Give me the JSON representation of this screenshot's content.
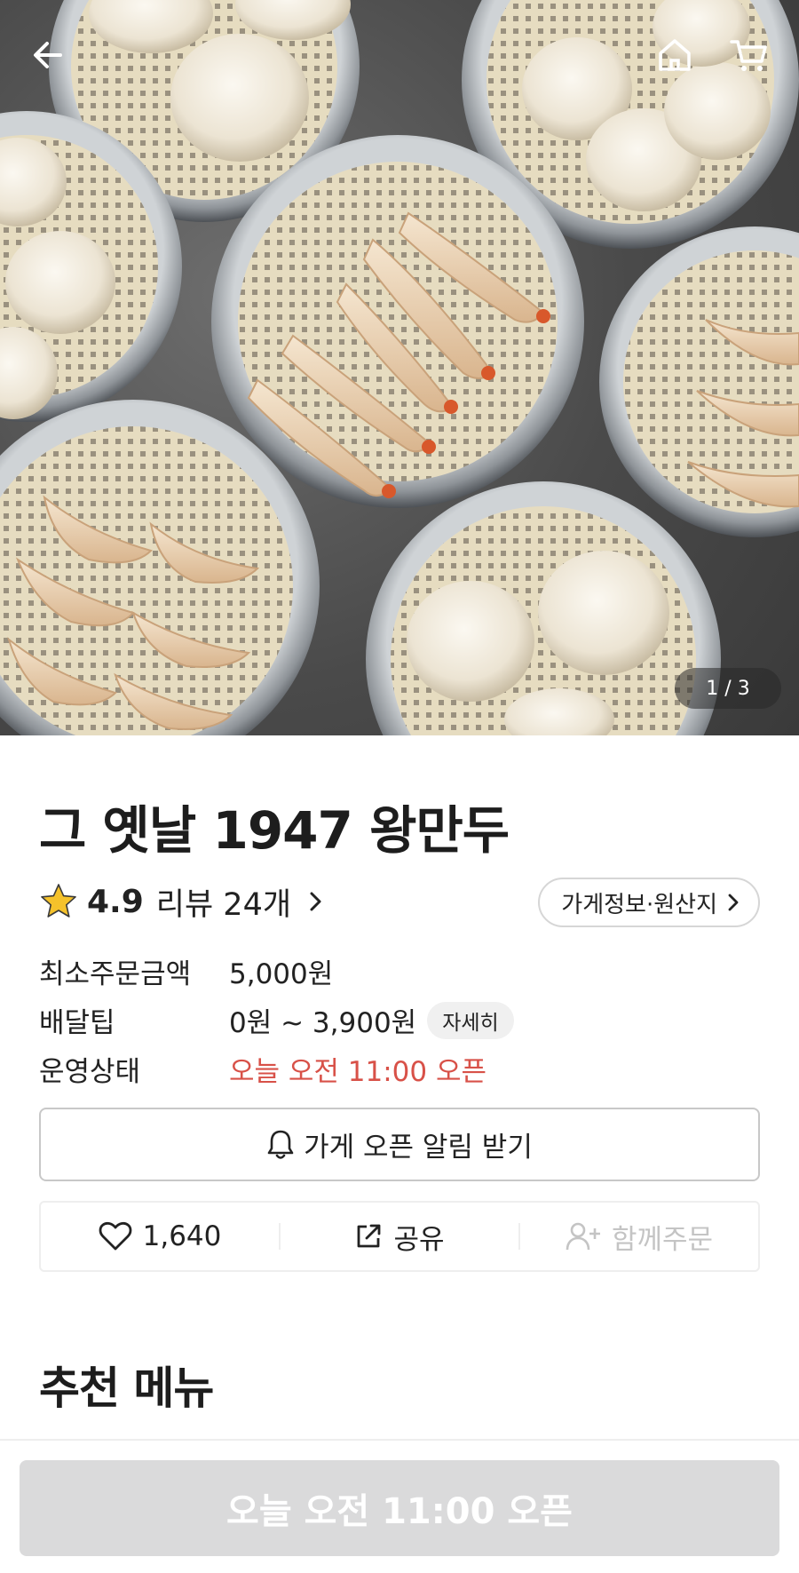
{
  "header": {
    "back_icon": "arrow-left-icon",
    "home_icon": "home-icon",
    "cart_icon": "cart-icon"
  },
  "gallery": {
    "counter": "1 / 3"
  },
  "store": {
    "name": "그 옛날 1947 왕만두",
    "rating": "4.9",
    "review_text": "리뷰 24개",
    "info_button": "가게정보·원산지"
  },
  "info": [
    {
      "key": "최소주문금액",
      "value": "5,000원"
    },
    {
      "key": "배달팁",
      "value": "0원 ~ 3,900원",
      "chip": "자세히"
    },
    {
      "key": "운영상태",
      "value": "오늘 오전 11:00 오픈"
    }
  ],
  "alarm_button": "가게 오픈 알림 받기",
  "actions": {
    "like_count": "1,640",
    "share": "공유",
    "group_order": "함께주문"
  },
  "section_title": "추천 메뉴",
  "cta": "오늘 오전 11:00 오픈",
  "colors": {
    "status_red": "#d85148",
    "cta_disabled": "#dadadb",
    "star": "#f5c22b"
  }
}
